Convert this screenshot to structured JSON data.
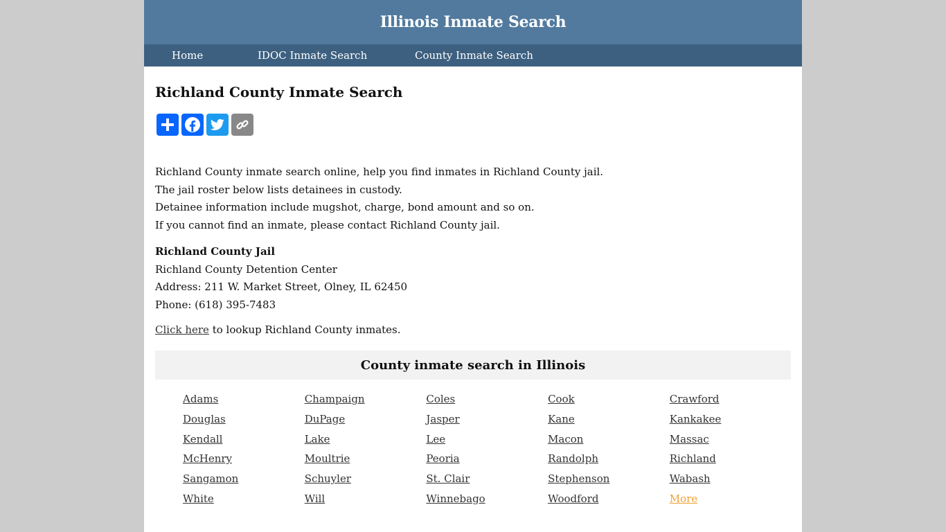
{
  "header": {
    "title": "Illinois Inmate Search"
  },
  "nav": {
    "items": [
      {
        "label": "Home"
      },
      {
        "label": "IDOC Inmate Search"
      },
      {
        "label": "County Inmate Search"
      }
    ]
  },
  "page": {
    "title": "Richland County Inmate Search",
    "share": [
      {
        "icon": "plus-icon",
        "color": "#0866ff"
      },
      {
        "icon": "facebook-icon",
        "color": "#0866ff"
      },
      {
        "icon": "twitter-icon",
        "color": "#1d9bf0"
      },
      {
        "icon": "link-icon",
        "color": "#888888"
      }
    ],
    "intro": [
      "Richland County inmate search online, help you find inmates in Richland County jail.",
      "The jail roster below lists detainees in custody.",
      "Detainee information include mugshot, charge, bond amount and so on.",
      "If you cannot find an inmate, please contact Richland County jail."
    ],
    "jail": {
      "name": "Richland County Jail",
      "facility": "Richland County Detention Center",
      "address": "Address: 211 W. Market Street, Olney, IL 62450",
      "phone": "Phone: (618) 395-7483"
    },
    "lookup": {
      "link": "Click here",
      "text": " to lookup Richland County inmates."
    }
  },
  "counties": {
    "heading": "County inmate search in Illinois",
    "items": [
      "Adams",
      "Champaign",
      "Coles",
      "Cook",
      "Crawford",
      "Douglas",
      "DuPage",
      "Jasper",
      "Kane",
      "Kankakee",
      "Kendall",
      "Lake",
      "Lee",
      "Macon",
      "Massac",
      "McHenry",
      "Moultrie",
      "Peoria",
      "Randolph",
      "Richland",
      "Sangamon",
      "Schuyler",
      "St. Clair",
      "Stephenson",
      "Wabash",
      "White",
      "Will",
      "Winnebago",
      "Woodford",
      "More"
    ]
  }
}
